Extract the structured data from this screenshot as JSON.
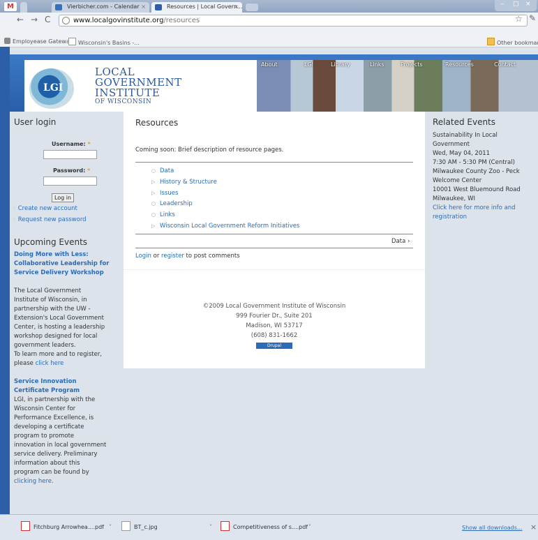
{
  "browser": {
    "tabs": [
      {
        "label": "Vierbicher.com - Calendar"
      },
      {
        "label": "Resources | Local Govern..."
      }
    ],
    "address": {
      "domain": "www.localgovinstitute.org",
      "path": "/resources"
    },
    "bookmarks": [
      "Employease Gateway",
      "Wisconsin's Basins -..."
    ],
    "other_bookmarks": "Other bookmarks"
  },
  "site": {
    "logo_initials": "LGI",
    "logo_lines": [
      "LOCAL",
      "GOVERNMENT",
      "INSTITUTE"
    ],
    "logo_sub": "OF WISCONSIN",
    "menu": [
      "About",
      "LGI",
      "Library",
      "Links",
      "Projects",
      "Resources",
      "Contact"
    ]
  },
  "login": {
    "title": "User login",
    "username_label": "Username:",
    "password_label": "Password:",
    "required": "*",
    "button": "Log in",
    "create": "Create new account",
    "reset": "Request new password"
  },
  "upcoming": {
    "title": "Upcoming Events",
    "event1_title": [
      "Doing More with Less:",
      "Collaborative Leadership for",
      "Service Delivery Workshop"
    ],
    "event1_body": [
      "The Local Government",
      "Institute of Wisconsin, in",
      "partnership with the UW -",
      "Extension's Local Government",
      "Center, is hosting a leadership",
      "workshop designed for local",
      "government leaders."
    ],
    "event1_more": "To learn more and to register,",
    "event1_more2": "please",
    "event1_link": "click here",
    "event2_title": [
      "Service Innovation",
      "Certificate Program"
    ],
    "event2_body": [
      "LGI, in partnership with the",
      "Wisconsin Center for",
      "Performance Excellence, is",
      "developing a certificate",
      "program to promote",
      "innovation in local government",
      "service delivery.  Preliminary",
      "information about this",
      "program can be found by"
    ],
    "event2_link": "clicking here."
  },
  "main": {
    "title": "Resources",
    "intro": "Coming soon: Brief description of resource pages.",
    "items": [
      "Data",
      "History & Structure",
      "Issues",
      "Leadership",
      "Links",
      "Wisconsin Local Government Reform Initiatives"
    ],
    "next": "Data ›",
    "login_link": "Login",
    "or": "or",
    "register_link": "register",
    "post_suffix": "to post comments",
    "footer": [
      "©2009 Local Government Institute of Wisconsin",
      "999 Fourier Dr., Suite 201",
      "Madison, WI 53717",
      "(608) 831-1662"
    ],
    "drupal": "Drupal"
  },
  "related": {
    "title": "Related Events",
    "lines": [
      "Sustainability In Local",
      "Government",
      "Wed, May 04, 2011",
      "7:30 AM - 5:30 PM (Central)",
      "Milwaukee County Zoo - Peck",
      "Welcome Center",
      "10001 West Bluemound Road",
      "Milwaukee, WI"
    ],
    "link": [
      "Click here for more info and",
      "registration"
    ]
  },
  "downloads": {
    "items": [
      "Fitchburg Arrowhea....pdf",
      "BT_c.jpg",
      "Competitiveness of s....pdf"
    ],
    "show_all": "Show all downloads..."
  },
  "colors": {
    "accent": "#2a6cb8",
    "header_blue": "#2d5fa8",
    "required": "#f39c12"
  }
}
